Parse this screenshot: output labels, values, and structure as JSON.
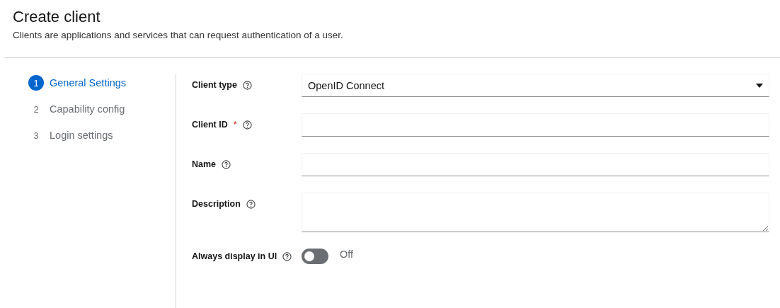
{
  "header": {
    "title": "Create client",
    "subtitle": "Clients are applications and services that can request authentication of a user."
  },
  "steps": [
    {
      "number": "1",
      "label": "General Settings",
      "selected": true
    },
    {
      "number": "2",
      "label": "Capability config",
      "selected": false
    },
    {
      "number": "3",
      "label": "Login settings",
      "selected": false
    }
  ],
  "fields": [
    {
      "kind": "select",
      "label": "Client type",
      "value": "OpenID Connect"
    },
    {
      "kind": "text",
      "label": "Client ID",
      "required_mark": "*"
    },
    {
      "kind": "text",
      "label": "Name"
    },
    {
      "kind": "textarea",
      "label": "Description"
    },
    {
      "kind": "switch",
      "label": "Always display in UI",
      "on": false,
      "state_text": "Off"
    }
  ]
}
